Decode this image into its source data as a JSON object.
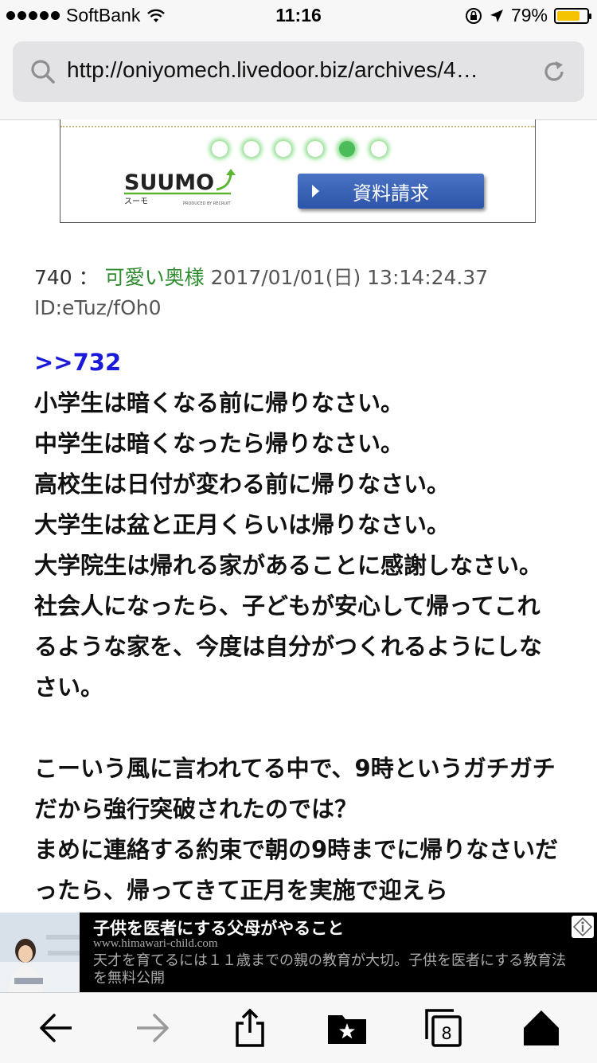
{
  "status_bar": {
    "carrier": "SoftBank",
    "time": "11:16",
    "battery_percent": "79%",
    "battery_level": 0.79,
    "icons": [
      "signal-dots-icon",
      "wifi-icon",
      "rotation-lock-icon",
      "location-arrow-icon",
      "battery-icon"
    ]
  },
  "url_bar": {
    "url": "http://oniyomech.livedoor.biz/archives/4…",
    "icons": [
      "search-icon",
      "reload-icon"
    ]
  },
  "top_ad": {
    "brand": "SUUMO",
    "brand_sub": "スーモ",
    "brand_note": "PRODUCED BY RECRUIT",
    "button_label": "資料請求",
    "carousel_count": 6,
    "carousel_active": 5,
    "accent_color": "#4cbc5b",
    "button_color": "#2c54a8"
  },
  "post": {
    "number": "740",
    "separator": "：",
    "name": "可愛い奥様",
    "date": "2017/01/01(日) 13:14:24.37",
    "id": "ID:eTuz/fOh0",
    "name_color": "#2e8b2e",
    "anchor": ">>732",
    "anchor_color": "#1a1ad8",
    "lines": [
      "小学生は暗くなる前に帰りなさい。",
      "中学生は暗くなったら帰りなさい。",
      "高校生は日付が変わる前に帰りなさい。",
      "大学生は盆と正月くらいは帰りなさい。",
      "大学院生は帰れる家があることに感謝しなさい。",
      "社会人になったら、子どもが安心して帰ってこれるような家を、今度は自分がつくれるようにしなさい。"
    ],
    "lines2": [
      "こーいう風に言われてる中で、9時というガチガチだから強行突破されたのでは？",
      "まめに連絡する約束で朝の9時までに帰りなさいだったら、帰ってきて正月を実施で迎えら"
    ]
  },
  "banner_ad": {
    "title": "子供を医者にする父母がやること",
    "url": "www.himawari-child.com",
    "description": "天才を育てるには１１歳までの親の教育が大切。子供を医者にする教育法を無料公開",
    "icons": [
      "ad-info-icon"
    ]
  },
  "toolbar": {
    "tab_count": "8",
    "icons": [
      "back-arrow-icon",
      "forward-arrow-icon",
      "share-icon",
      "bookmarks-icon",
      "tabs-icon",
      "home-icon"
    ]
  }
}
